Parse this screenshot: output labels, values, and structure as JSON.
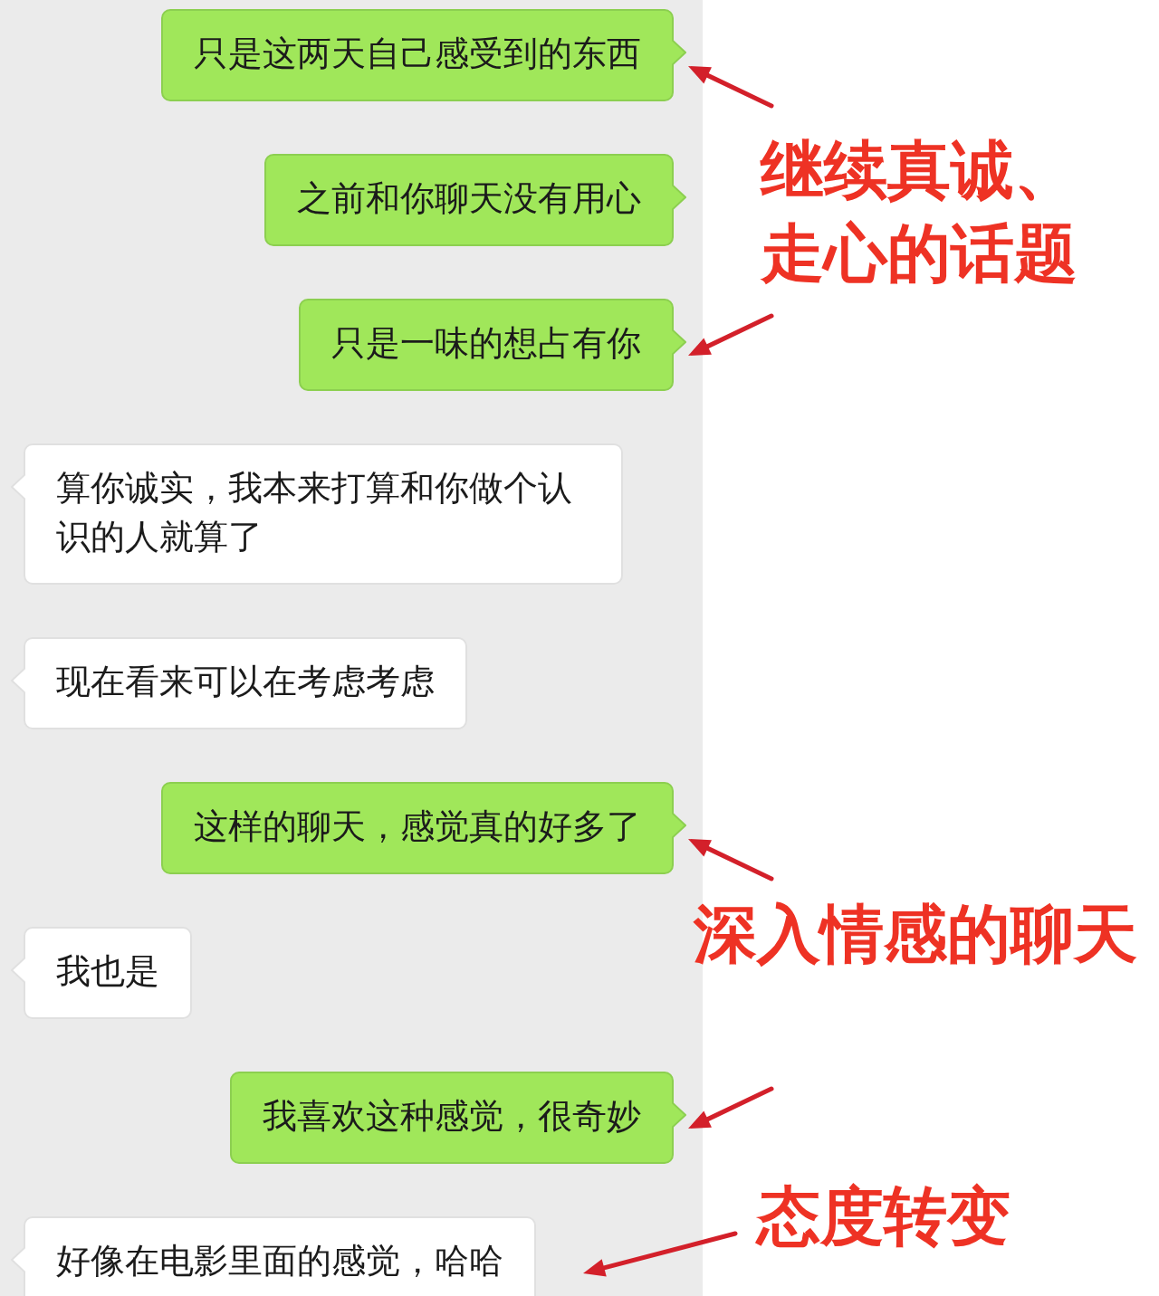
{
  "chat": {
    "messages": [
      {
        "kind": "sent",
        "text": "只是这两天自己感受到的东西",
        "arrow": true
      },
      {
        "kind": "sent",
        "text": "之前和你聊天没有用心",
        "arrow": false
      },
      {
        "kind": "sent",
        "text": "只是一味的想占有你",
        "arrow": true
      },
      {
        "kind": "received",
        "text": "算你诚实，我本来打算和你做个认识的人就算了",
        "arrow": false
      },
      {
        "kind": "received",
        "text": "现在看来可以在考虑考虑",
        "arrow": false
      },
      {
        "kind": "sent",
        "text": "这样的聊天，感觉真的好多了",
        "arrow": true
      },
      {
        "kind": "received",
        "text": "我也是",
        "arrow": false
      },
      {
        "kind": "sent",
        "text": "我喜欢这种感觉，很奇妙",
        "arrow": true
      },
      {
        "kind": "received",
        "text": "好像在电影里面的感觉，哈哈",
        "arrow": true
      }
    ]
  },
  "annotations": [
    {
      "text": "继续真诚、走心的话题"
    },
    {
      "text": "深入情感的聊天"
    },
    {
      "text": "态度转变"
    }
  ]
}
